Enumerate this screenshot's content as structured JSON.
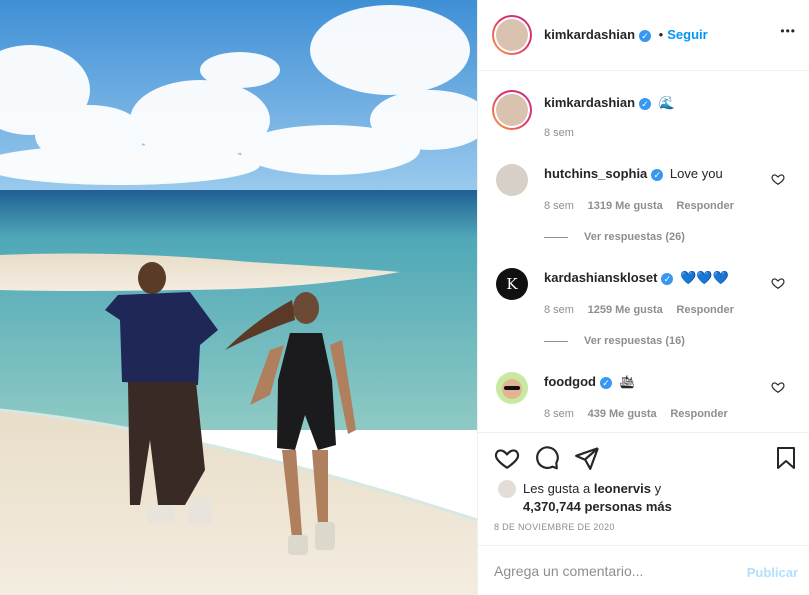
{
  "post": {
    "author": "kimkardashian",
    "follow_label": "Seguir",
    "more_label": "•••",
    "caption_emoji": "🌊",
    "caption_age": "8 sem"
  },
  "comments": [
    {
      "user": "hutchins_sophia",
      "text": "Love you",
      "age": "8 sem",
      "likes": "1319 Me gusta",
      "reply": "Responder",
      "view_replies": "Ver respuestas (26)"
    },
    {
      "user": "kardashianskloset",
      "text": "💙💙💙",
      "age": "8 sem",
      "likes": "1259 Me gusta",
      "reply": "Responder",
      "view_replies": "Ver respuestas (16)"
    },
    {
      "user": "foodgod",
      "text": "🛳",
      "age": "8 sem",
      "likes": "439 Me gusta",
      "reply": "Responder"
    }
  ],
  "likes": {
    "prefix": "Les gusta a",
    "user": "leonervis",
    "connector": "y",
    "count": "4,370,744 personas más"
  },
  "date": "8 DE NOVIEMBRE DE 2020",
  "comment_box": {
    "placeholder": "Agrega un comentario...",
    "publish_label": "Publicar"
  },
  "colors": {
    "accent": "#0095f6",
    "verified": "#3897f0",
    "publish_disabled": "#b2dffc"
  },
  "icons": [
    "verified-badge-icon",
    "more-options-icon",
    "heart-icon",
    "comment-icon",
    "share-icon",
    "bookmark-icon"
  ]
}
